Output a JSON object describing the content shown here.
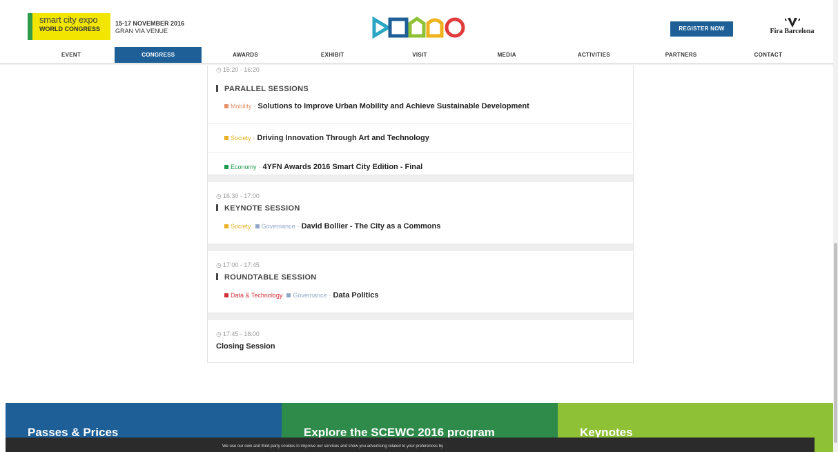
{
  "header": {
    "logo_line1": "smart city expo",
    "logo_line2": "WORLD CONGRESS",
    "event_date": "15-17 NOVEMBER 2016",
    "event_venue": "GRAN VIA VENUE",
    "register_label": "REGISTER NOW",
    "partner_logo_text": "Fira Barcelona"
  },
  "nav": {
    "items": [
      {
        "label": "EVENT",
        "active": false
      },
      {
        "label": "CONGRESS",
        "active": true
      },
      {
        "label": "AWARDS",
        "active": false
      },
      {
        "label": "EXHIBIT",
        "active": false
      },
      {
        "label": "VISIT",
        "active": false
      },
      {
        "label": "MEDIA",
        "active": false
      },
      {
        "label": "ACTIVITIES",
        "active": false
      },
      {
        "label": "PARTNERS",
        "active": false
      },
      {
        "label": "CONTACT",
        "active": false
      }
    ]
  },
  "program": {
    "block1": {
      "time": "15:20 - 16:20",
      "title": "PARALLEL SESSIONS",
      "talks": [
        {
          "tag": "Mobility",
          "tag_color": "#e8906a",
          "title": "Solutions to Improve Urban Mobility and Achieve Sustainable Development"
        },
        {
          "tag": "Society",
          "tag_color": "#e9b023",
          "title": "Driving Innovation Through Art and Technology"
        },
        {
          "tag": "Economy",
          "tag_color": "#1d9a4b",
          "title": "4YFN Awards 2016 Smart City Edition - Final"
        }
      ]
    },
    "block2": {
      "time": "16:30 - 17:00",
      "title": "KEYNOTE SESSION",
      "tag1": "Society",
      "tag1_color": "#e9b023",
      "tag2": "Governance",
      "tag2_color": "#8fa8c8",
      "talk_title": "David Bollier - The City as a Commons"
    },
    "block3": {
      "time": "17:00 - 17:45",
      "title": "ROUNDTABLE SESSION",
      "tag1": "Data & Technology",
      "tag1_color": "#d0303a",
      "tag2": "Governance",
      "tag2_color": "#8fa8c8",
      "talk_title": "Data Politics"
    },
    "block4": {
      "time": "17:45 - 18:00",
      "title": "Closing Session"
    }
  },
  "tiles": {
    "passes": "Passes & Prices",
    "explore": "Explore the SCEWC 2016 program",
    "keynotes": "Keynotes"
  },
  "cookie": {
    "text": "We use our own and third-party cookies to improve our services and show you advertising related to your preferences by"
  },
  "colors": {
    "brand_blue": "#1d5f96",
    "brand_green": "#2e8b4a",
    "brand_lime": "#8fc136",
    "logo_yellow": "#f2e600"
  }
}
